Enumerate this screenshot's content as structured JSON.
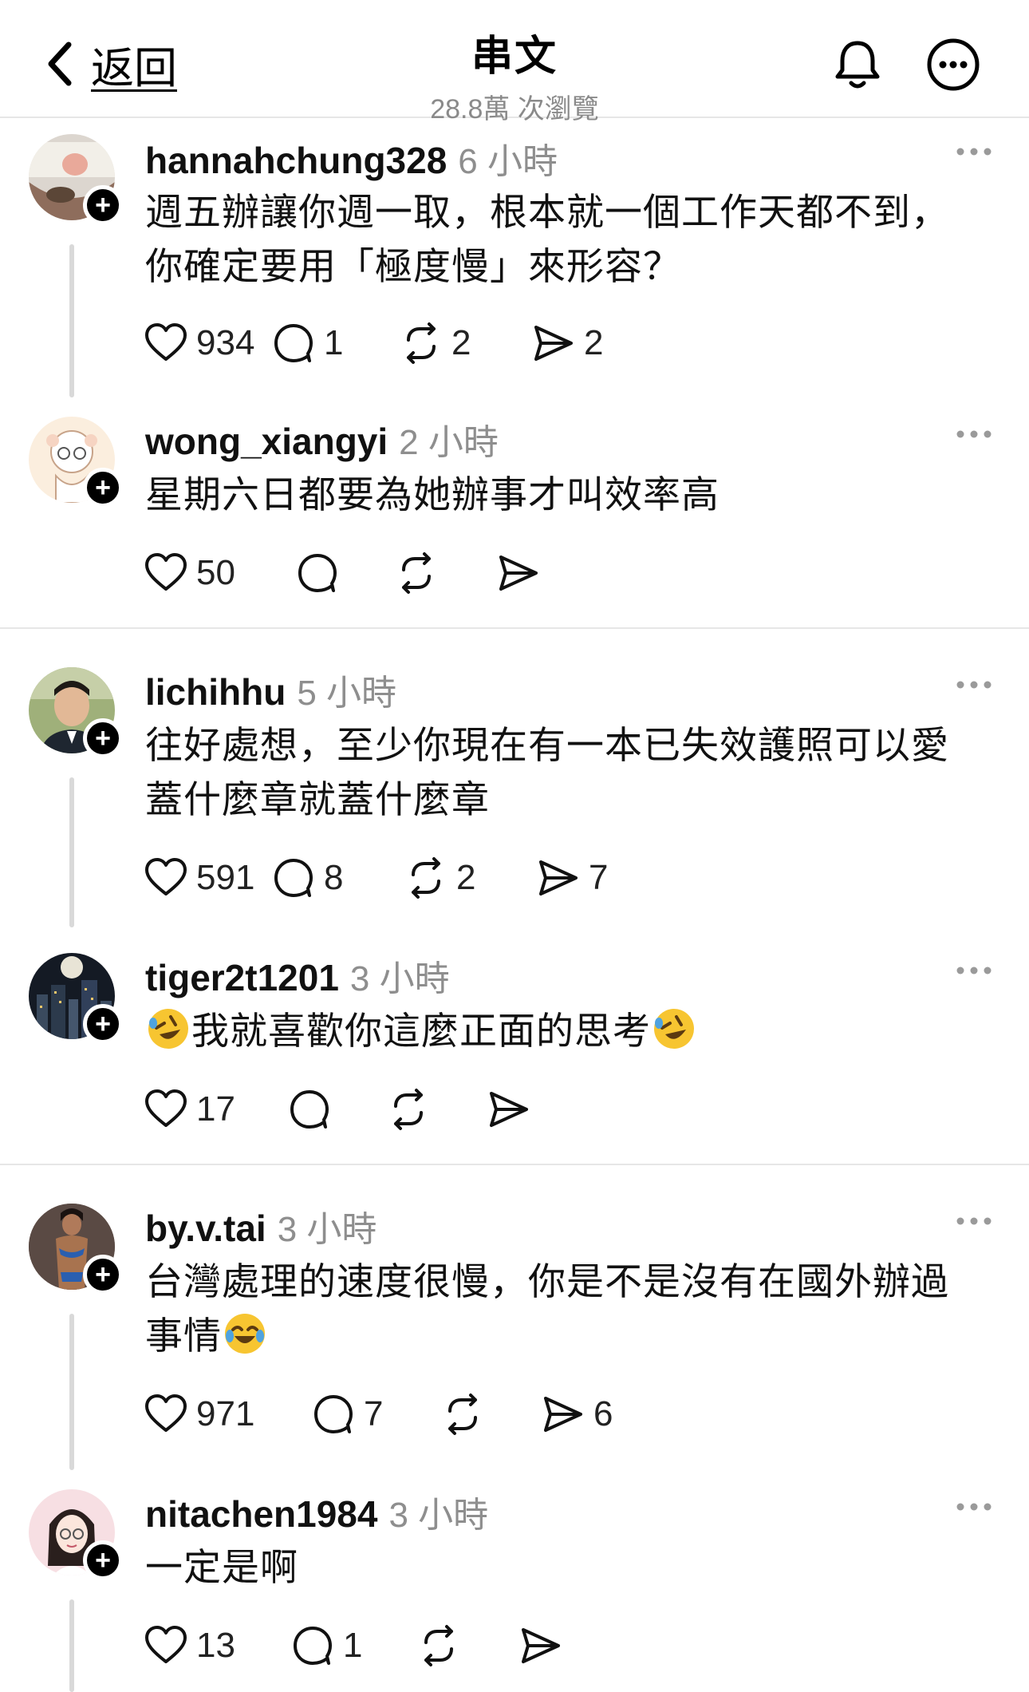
{
  "header": {
    "back_label": "返回",
    "title": "串文",
    "views": "28.8萬 次瀏覽"
  },
  "posts": [
    {
      "username": "hannahchung328",
      "time": "6 小時",
      "text_lines": [
        "週五辦讓你週一取，根本就一個工作天都不到，",
        "你確定要用「極度慢」來形容？"
      ],
      "likes": "934",
      "replies": "1",
      "reposts": "2",
      "shares": "2"
    },
    {
      "username": "wong_xiangyi",
      "time": "2 小時",
      "text_lines": [
        "星期六日都要為她辦事才叫效率高"
      ],
      "likes": "50",
      "replies": "",
      "reposts": "",
      "shares": ""
    },
    {
      "username": "lichihhu",
      "time": "5 小時",
      "text_lines": [
        "往好處想，至少你現在有一本已失效護照可以愛",
        "蓋什麼章就蓋什麼章"
      ],
      "likes": "591",
      "replies": "8",
      "reposts": "2",
      "shares": "7"
    },
    {
      "username": "tiger2t1201",
      "time": "3 小時",
      "text": "我就喜歡你這麼正面的思考",
      "likes": "17",
      "replies": "",
      "reposts": "",
      "shares": ""
    },
    {
      "username": "by.v.tai",
      "time": "3 小時",
      "text_lines": [
        "台灣處理的速度很慢，你是不是沒有在國外辦過",
        "事情"
      ],
      "likes": "971",
      "replies": "7",
      "reposts": "",
      "shares": "6"
    },
    {
      "username": "nitachen1984",
      "time": "3 小時",
      "text_lines": [
        "一定是啊"
      ],
      "likes": "13",
      "replies": "1",
      "reposts": "",
      "shares": ""
    }
  ],
  "icons": {
    "back": "chevron-left-icon",
    "bell": "bell-icon",
    "more": "more-circle-icon",
    "like": "heart-icon",
    "reply": "comment-icon",
    "repost": "repost-icon",
    "share": "send-icon",
    "post_more": "more-dots-icon",
    "follow": "plus-icon",
    "emoji": "rofl-emoji / joy-emoji"
  },
  "colors": {
    "text": "#111111",
    "muted": "#8e8e8e",
    "divider": "#e6e6e6",
    "thread_line": "#d9d9d9"
  }
}
